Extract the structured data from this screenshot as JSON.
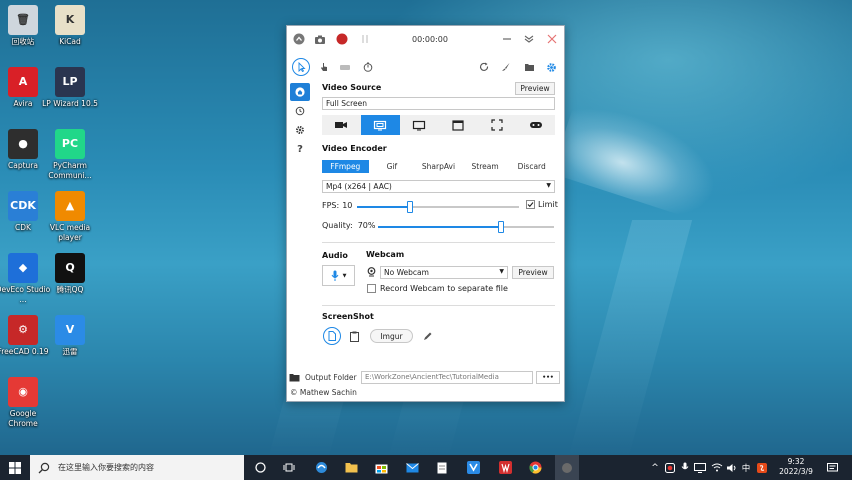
{
  "desktop": {
    "icons": [
      {
        "label": "回收站",
        "icon": "recycle-bin-icon",
        "color": "#cfd6dd"
      },
      {
        "label": "KiCad",
        "icon": "kicad-icon",
        "color": "#e8e0c8"
      },
      {
        "label": "Avira",
        "icon": "avira-icon",
        "color": "#d92027"
      },
      {
        "label": "LP Wizard 10.5",
        "icon": "lp-wizard-icon",
        "color": "#2a3550"
      },
      {
        "label": "Captura",
        "icon": "captura-icon",
        "color": "#2e2e2e"
      },
      {
        "label": "PyCharm Communi...",
        "icon": "pycharm-icon",
        "color": "#21d789"
      },
      {
        "label": "CDK",
        "icon": "cdk-icon",
        "color": "#2a7fd6"
      },
      {
        "label": "VLC media player",
        "icon": "vlc-icon",
        "color": "#f08a00"
      },
      {
        "label": "DevEco Studio ...",
        "icon": "deveco-icon",
        "color": "#1e6fd9"
      },
      {
        "label": "腾讯QQ",
        "icon": "qq-icon",
        "color": "#111111"
      },
      {
        "label": "FreeCAD 0.19",
        "icon": "freecad-icon",
        "color": "#c62828"
      },
      {
        "label": "迅雷",
        "icon": "xunlei-icon",
        "color": "#2b8be6"
      },
      {
        "label": "Google Chrome",
        "icon": "chrome-icon",
        "color": "#e53935"
      }
    ]
  },
  "window": {
    "timer": "00:00:00",
    "video_source": {
      "title": "Video Source",
      "preview_label": "Preview",
      "value": "Full Screen",
      "sources": [
        "camera-icon",
        "screen-icon",
        "monitor-icon",
        "window-icon",
        "region-icon",
        "gamepad-icon"
      ],
      "active_index": 1
    },
    "video_encoder": {
      "title": "Video Encoder",
      "tabs": [
        "FFmpeg",
        "Gif",
        "SharpAvi",
        "Stream",
        "Discard"
      ],
      "active_tab": 0,
      "format": "Mp4 (x264 | AAC)",
      "fps_label": "FPS:",
      "fps_value": "10",
      "fps_level": 0.33,
      "limit_label": "Limit",
      "limit_checked": true,
      "quality_label": "Quality:",
      "quality_value": "70%",
      "quality_level": 0.7
    },
    "audio": {
      "title": "Audio"
    },
    "webcam": {
      "title": "Webcam",
      "value": "No Webcam",
      "preview_label": "Preview",
      "separate_label": "Record Webcam to separate file"
    },
    "screenshot": {
      "title": "ScreenShot",
      "imgur_label": "Imgur"
    },
    "output": {
      "label": "Output Folder",
      "path": "E:\\WorkZone\\AncientTec\\TutorialMedia",
      "more": "•••"
    },
    "copyright": "© Mathew Sachin"
  },
  "taskbar": {
    "search_placeholder": "在这里输入你要搜索的内容",
    "ime": "中",
    "time": "9:32",
    "date": "2022/3/9"
  },
  "colors": {
    "accent": "#1e88e5",
    "record": "#c62828"
  }
}
